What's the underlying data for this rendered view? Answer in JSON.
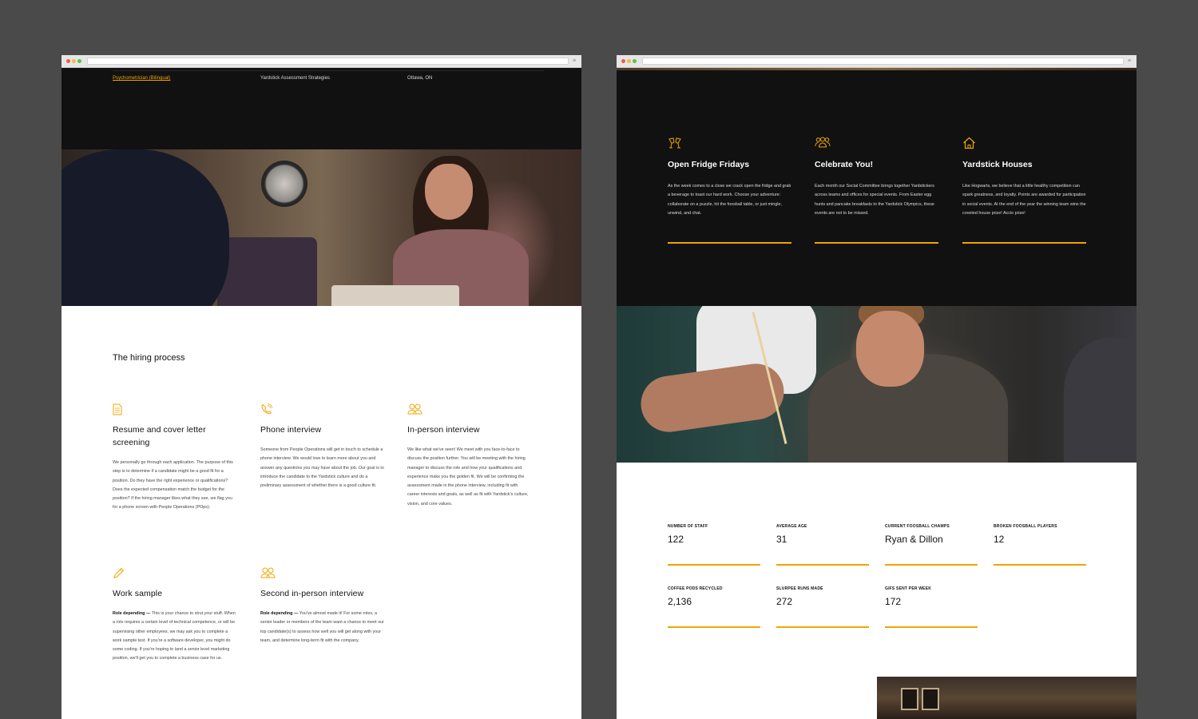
{
  "colors": {
    "accent": "#f0a500",
    "dark_bg": "#111111",
    "page_bg": "#4a4a4a"
  },
  "left_page": {
    "job_row": {
      "title": "Psychometrician (Bilingual)",
      "team": "Yardstick Assessment Strategies",
      "location": "Ottawa, ON"
    },
    "section_title": "The hiring process",
    "steps": [
      {
        "icon": "document-icon",
        "title": "Resume and cover letter screening",
        "body": "We personally go through each application. The purpose of this step is to determine if a candidate might be a good fit for a position. Do they have the right experience or qualifications? Does the expected compensation match the budget for the position? If the hiring manager likes what they see, we flag you for a phone screen with People Operations (POps)."
      },
      {
        "icon": "phone-icon",
        "title": "Phone interview",
        "body": "Someone from People Operations will get in touch to schedule a phone interview. We would love to learn more about you and answer any questions you may have about the job. Our goal is to introduce the candidate to the Yardstick culture and do a preliminary assessment of whether there is a good culture fit."
      },
      {
        "icon": "people-icon",
        "title": "In-person interview",
        "body": "We like what we've seen! We meet with you face-to-face to discuss the position further. You will be meeting with the hiring manager to discuss the role and how your qualifications and experience make you the golden fit. We will be confirming the assessment made in the phone interview, including fit with career interests and goals, as well as fit with Yardstick's culture, vision, and core values."
      },
      {
        "icon": "pencil-icon",
        "title": "Work sample",
        "lead": "Role depending —",
        "body": " This is your chance to strut your stuff. When a role requires a certain level of technical competence, or will be supervising other employees, we may ask you to complete a work sample test. If you're a software developer, you might do some coding. If you're hoping to land a senior level marketing position, we'll get you to complete a business case for us."
      },
      {
        "icon": "people-icon",
        "title": "Second in-person interview",
        "lead": "Role depending —",
        "body": " You've almost made it! For some roles, a senior leader or members of the team want a chance to meet our top candidate(s) to assess how well you will get along with your team, and determine long-term fit with the company."
      }
    ]
  },
  "right_page": {
    "perks": [
      {
        "icon": "cheers-icon",
        "title": "Open Fridge Fridays",
        "body": "As the week comes to a close we crack open the fridge and grab a beverage to toast our hard work. Choose your adventure: collaborate on a puzzle, hit the foosball table, or just mingle, unwind, and chat."
      },
      {
        "icon": "group-icon",
        "title": "Celebrate You!",
        "body": "Each month our Social Committee brings together Yardstickers across teams and offices for special events. From Easter egg hunts and pancake breakfasts to the Yardstick Olympics, these events are not to be missed."
      },
      {
        "icon": "house-icon",
        "title": "Yardstick Houses",
        "body": "Like Hogwarts, we believe that a little healthy competition can spark greatness, and loyalty. Points are awarded for participation in social events. At the end of the year the winning team wins the coveted house prize! Accio prize!"
      }
    ],
    "stats": [
      {
        "label": "NUMBER OF STAFF",
        "value": "122"
      },
      {
        "label": "AVERAGE AGE",
        "value": "31"
      },
      {
        "label": "CURRENT FOOSBALL CHAMPS",
        "value": "Ryan & Dillon"
      },
      {
        "label": "BROKEN FOOSBALL PLAYERS",
        "value": "12"
      },
      {
        "label": "COFFEE PODS RECYCLED",
        "value": "2,136"
      },
      {
        "label": "SLURPEE RUNS MADE",
        "value": "272"
      },
      {
        "label": "GIFS SENT PER WEEK",
        "value": "172"
      }
    ]
  }
}
